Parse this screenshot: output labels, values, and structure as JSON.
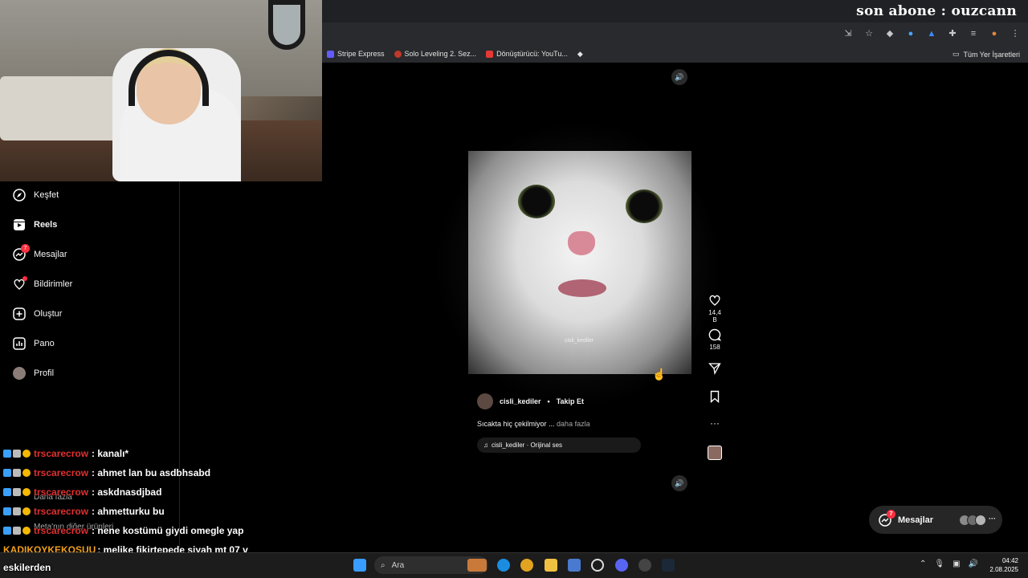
{
  "overlay": {
    "subscriber_text": "son abone : ouzcann"
  },
  "bookmarks": {
    "items": [
      {
        "label": "Stripe Express",
        "icon": "stripe-icon",
        "color": "#635bff"
      },
      {
        "label": "Solo Leveling 2. Sez...",
        "icon": "solo-leveling-icon",
        "color": "#c0392b"
      },
      {
        "label": "Dönüştürücü: YouTu...",
        "icon": "converter-icon",
        "color": "#e53935"
      }
    ],
    "all_label": "Tüm Yer İşaretleri"
  },
  "sidebar": {
    "items": [
      {
        "label": "Keşfet",
        "icon": "compass-icon"
      },
      {
        "label": "Reels",
        "icon": "reels-icon",
        "active": true
      },
      {
        "label": "Mesajlar",
        "icon": "messenger-icon",
        "badge": "7"
      },
      {
        "label": "Bildirimler",
        "icon": "heart-icon",
        "dot": true
      },
      {
        "label": "Oluştur",
        "icon": "plus-square-icon"
      },
      {
        "label": "Pano",
        "icon": "dashboard-icon"
      },
      {
        "label": "Profil",
        "icon": "profile-avatar"
      }
    ],
    "more_label": "Daha fazla",
    "meta_label": "Meta'nın diğer ürünleri"
  },
  "reel": {
    "watermark": "cisli_kediler",
    "author": "cisli_kediler",
    "separator": "•",
    "follow_label": "Takip Et",
    "caption": "Sıcakta hiç çekilmiyor ...",
    "caption_more": "daha fazla",
    "audio": "cisli_kediler · Orijinal ses",
    "likes": "14,4 B",
    "comments": "158"
  },
  "messages_pill": {
    "label": "Mesajlar",
    "badge": "7"
  },
  "chat": [
    {
      "user": "trscarecrow",
      "text": ": kanalı*"
    },
    {
      "user": "trscarecrow",
      "text": ": ahmet lan bu asdbhsabd"
    },
    {
      "user": "trscarecrow",
      "text": ": askdnasdjbad"
    },
    {
      "user": "trscarecrow",
      "text": ": ahmetturku bu"
    },
    {
      "user": "trscarecrow",
      "text": ": nene kostümü giydi omegle yap"
    },
    {
      "user": "KADIKOYKEKOSUU",
      "text": ": melike fikirtepede siyah mt 07 v"
    },
    {
      "user": "",
      "text": "eskilerden"
    }
  ],
  "taskbar": {
    "search_placeholder": "Ara",
    "time": "04:42",
    "date": "2.08.2025"
  }
}
